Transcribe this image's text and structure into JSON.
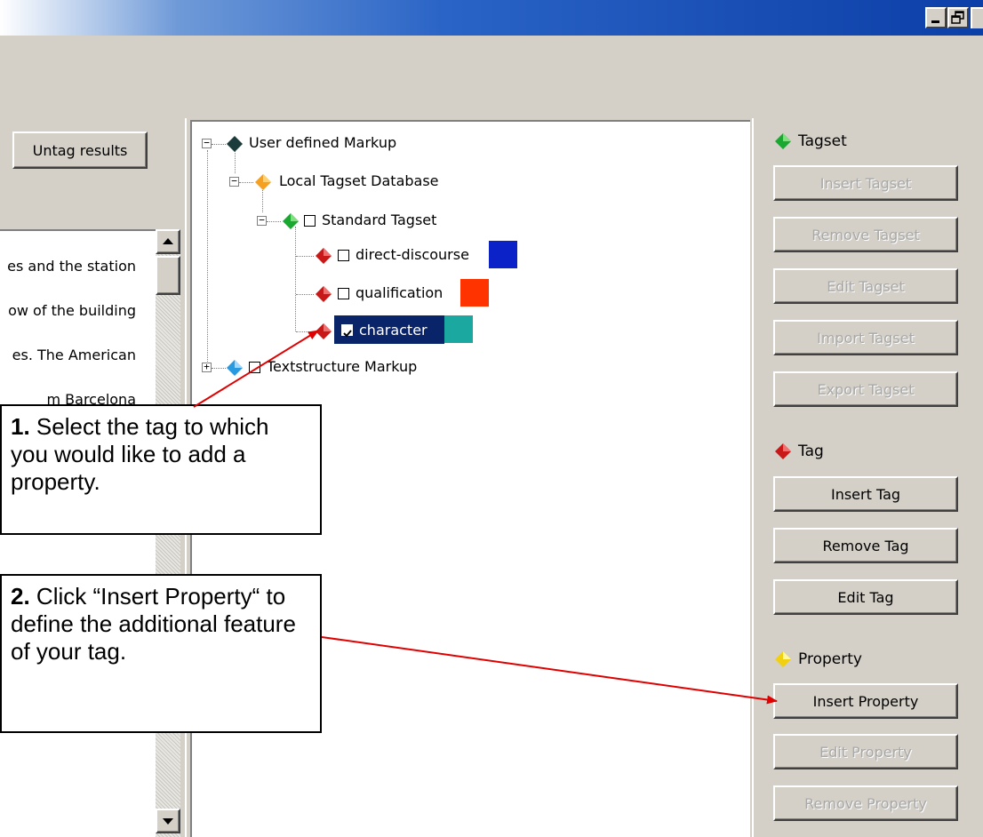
{
  "window": {
    "minimize_icon": "minimize-icon",
    "restore_icon": "restore-icon"
  },
  "left": {
    "untag_label": "Untag results",
    "lines": [
      "es and the station",
      "ow of the building",
      "es. The American",
      "m Barcelona"
    ]
  },
  "tree": {
    "nodes": [
      {
        "label": "User defined Markup"
      },
      {
        "label": "Local Tagset Database"
      },
      {
        "label": "Standard Tagset"
      },
      {
        "label": "direct-discourse",
        "color": "#0a22c8"
      },
      {
        "label": "qualification",
        "color": "#ff3300"
      },
      {
        "label": "character",
        "color": "#1aa8a0",
        "checked": true,
        "selected": true
      },
      {
        "label": "Textstructure Markup"
      }
    ]
  },
  "panel": {
    "tagset_header": "Tagset",
    "tagset_buttons": [
      "Insert Tagset",
      "Remove Tagset",
      "Edit Tagset",
      "Import Tagset",
      "Export Tagset"
    ],
    "tag_header": "Tag",
    "tag_buttons": [
      "Insert Tag",
      "Remove Tag",
      "Edit Tag"
    ],
    "property_header": "Property",
    "property_buttons": [
      "Insert Property",
      "Edit Property",
      "Remove Property"
    ]
  },
  "callouts": {
    "one_num": "1.",
    "one_text": " Select the tag to which you would like to add a property.",
    "two_num": "2.",
    "two_text": " Click “Insert Property“ to define the additional feature of your tag."
  },
  "colors": {
    "tagset_icon": "#1aa830",
    "tag_icon": "#d01818",
    "property_icon": "#f0e020",
    "selection": "#0a246a",
    "arrow": "#e00000"
  }
}
